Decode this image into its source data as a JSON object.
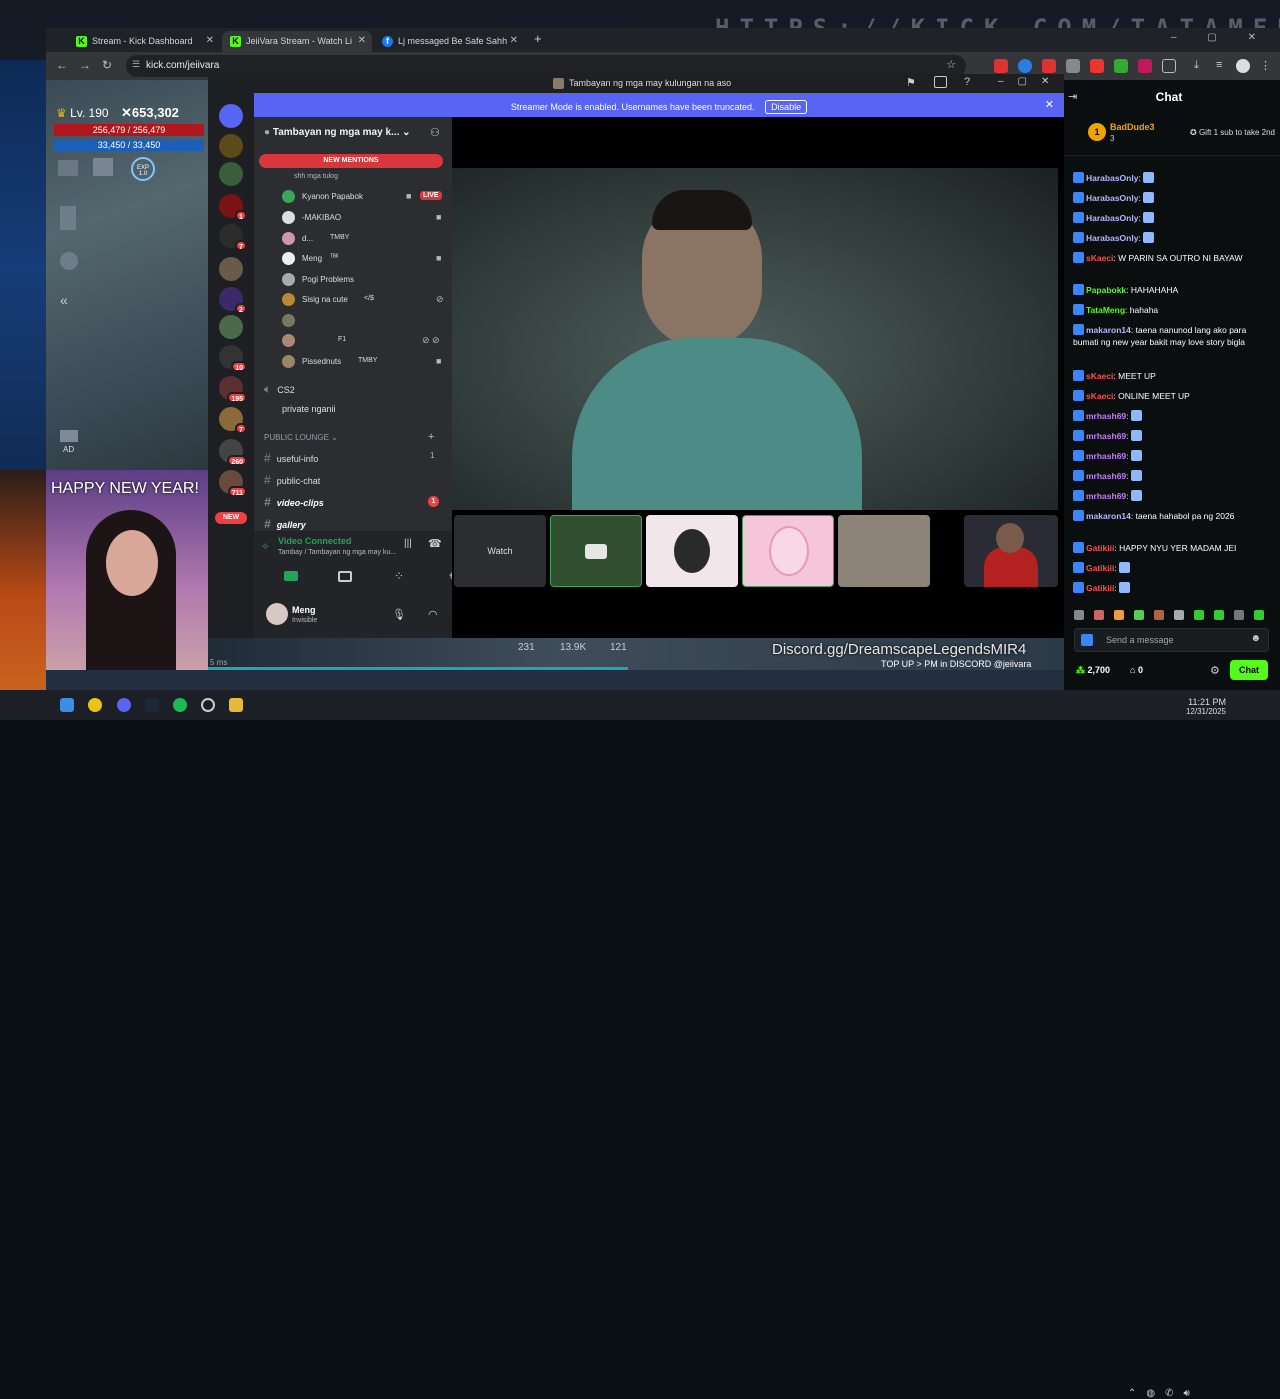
{
  "browser": {
    "tabs": [
      {
        "label": "Stream - Kick Dashboard",
        "icon": "kick-icon"
      },
      {
        "label": "JeiiVara Stream - Watch Li",
        "icon": "kick-icon"
      },
      {
        "label": "Lj messaged Be Safe Sahh",
        "icon": "facebook-icon"
      }
    ],
    "url": "kick.com/jeiivara",
    "background_url": "HTTPS://KICK.COM/TATAMENG"
  },
  "game": {
    "level": "Lv. 190",
    "power": "653,302",
    "hp": "256,479 / 256,479",
    "mp": "33,450 / 33,450",
    "exp": "EXP 1.0",
    "stats_bottom": [
      "231",
      "13.9K",
      "121"
    ],
    "ad": "AD",
    "discord_promo": "Discord.gg/DreamscapeLegendsMIR4",
    "topup": "TOP UP > PM in DISCORD @jeiivara",
    "ms": "5 ms"
  },
  "webcam": {
    "caption": "HAPPY NEW YEAR!"
  },
  "discord": {
    "window_title": "Tambayan ng mga may kulungan na aso",
    "banner_text": "Streamer Mode is enabled. Usernames have been truncated.",
    "banner_button": "Disable",
    "server_name": "Tambayan ng mga may k...",
    "new_mentions": "NEW MENTIONS",
    "status_line": "shh mga tulog",
    "voice_users": [
      {
        "name": "Kyanon Papabok",
        "tag": "LIVE"
      },
      {
        "name": "-MAKIBAO",
        "tag": ""
      },
      {
        "name": "d...",
        "tag": "TMBY"
      },
      {
        "name": "Meng",
        "tag": "ᵀᴮᴵᴵ"
      },
      {
        "name": "Pogi Problems",
        "tag": ""
      },
      {
        "name": "Sisig na cute",
        "tag": "</$"
      },
      {
        "name": "",
        "tag": ""
      },
      {
        "name": "",
        "tag": "F1"
      },
      {
        "name": "Pissednuts",
        "tag": "TMBY"
      }
    ],
    "channels": [
      {
        "name": "CS2",
        "type": "voice"
      },
      {
        "name": "private nganii",
        "type": "voice"
      }
    ],
    "category": "PUBLIC LOUNGE",
    "text_channels": [
      {
        "name": "useful-info",
        "badge": "1"
      },
      {
        "name": "public-chat",
        "badge": ""
      },
      {
        "name": "video-clips",
        "badge": "1"
      },
      {
        "name": "gallery",
        "badge": ""
      }
    ],
    "server_badges": [
      "1",
      "7",
      "2",
      "10",
      "195",
      "7",
      "260",
      "711"
    ],
    "new_label": "NEW",
    "vc_status": "Video Connected",
    "vc_channel": "Tambay / Tambayan ng mga may ku...",
    "user_name": "Meng",
    "user_status": "Invisible",
    "watch_label": "Watch"
  },
  "chat": {
    "title": "Chat",
    "gifter": "BadDude3",
    "gifter_count": "3",
    "gift_text": "Gift 1 sub to take 2nd",
    "messages": [
      {
        "user": "HarabasOnly",
        "text": "",
        "color": "#b3b8ff"
      },
      {
        "user": "HarabasOnly",
        "text": "",
        "color": "#b3b8ff"
      },
      {
        "user": "HarabasOnly",
        "text": "",
        "color": "#b3b8ff"
      },
      {
        "user": "HarabasOnly",
        "text": "",
        "color": "#b3b8ff"
      },
      {
        "user": "sKaeci",
        "text": "W PARIN SA OUTRO NI BAYAW",
        "color": "#ff4d4d"
      },
      {
        "user": "Papabokk",
        "text": "HAHAHAHA",
        "color": "#53fc18"
      },
      {
        "user": "TataMeng",
        "text": "hahaha",
        "color": "#53fc18"
      },
      {
        "user": "makaron14",
        "text": "taena nanunod lang ako para bumati ng new year bakit may love story bigla",
        "color": "#b3b8ff"
      },
      {
        "user": "sKaeci",
        "text": "MEET UP",
        "color": "#ff4d4d"
      },
      {
        "user": "sKaeci",
        "text": "ONLINE MEET UP",
        "color": "#ff4d4d"
      },
      {
        "user": "mrhash69",
        "text": "",
        "color": "#c47dff"
      },
      {
        "user": "mrhash69",
        "text": "",
        "color": "#c47dff"
      },
      {
        "user": "mrhash69",
        "text": "",
        "color": "#c47dff"
      },
      {
        "user": "mrhash69",
        "text": "",
        "color": "#c47dff"
      },
      {
        "user": "mrhash69",
        "text": "",
        "color": "#c47dff"
      },
      {
        "user": "makaron14",
        "text": "taena hahabol pa ng 2026",
        "color": "#b3b8ff"
      },
      {
        "user": "Gatikiii",
        "text": "HAPPY NYU YER MADAM JEI",
        "color": "#ff4d4d"
      },
      {
        "user": "Gatikiii",
        "text": "",
        "color": "#ff4d4d"
      },
      {
        "user": "Gatikiii",
        "text": "",
        "color": "#ff4d4d"
      }
    ],
    "input_placeholder": "Send a message",
    "points": "2,700",
    "zero": "0",
    "chat_button": "Chat"
  },
  "taskbar": {
    "time": "11:21 PM",
    "date": "12/31/2025"
  }
}
